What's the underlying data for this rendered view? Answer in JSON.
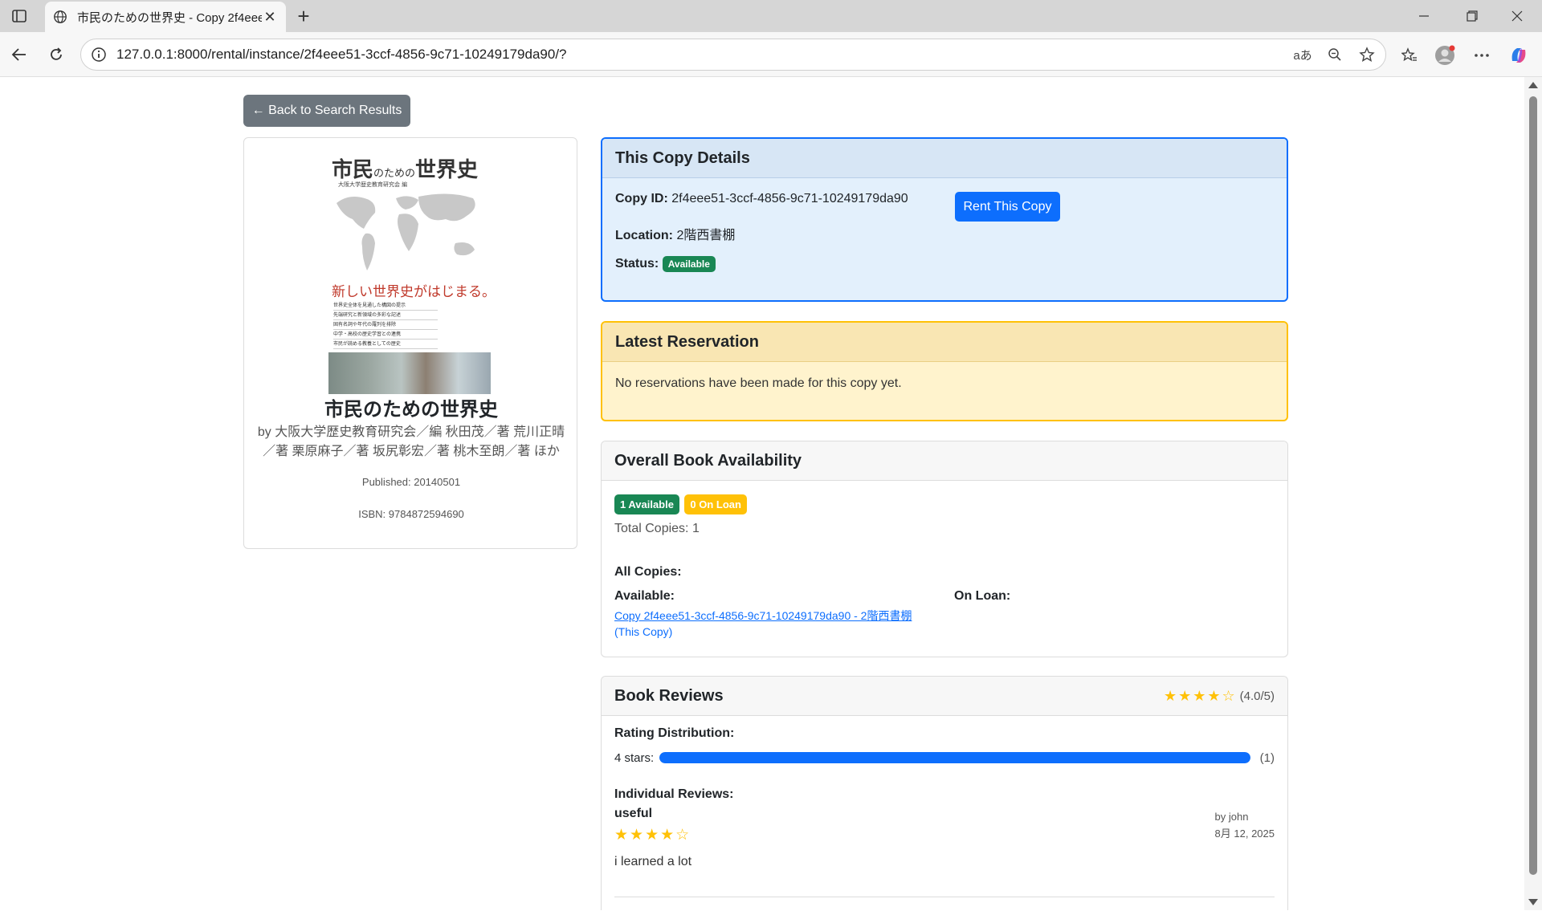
{
  "browser": {
    "tab_title": "市民のための世界史 - Copy 2f4eee",
    "url": "127.0.0.1:8000/rental/instance/2f4eee51-3ccf-4856-9c71-10249179da90/?",
    "translate_icon_text": "aあ"
  },
  "page": {
    "back_button": "← Back to Search Results"
  },
  "book": {
    "cover": {
      "title_a": "市民",
      "title_b": "のための",
      "title_c": "世界史",
      "subtitle": "大阪大学歴史教育研究会 編",
      "tagline": "新しい世界史がはじまる。",
      "lines": [
        "世界史全体を見通した構図の提示",
        "先端研究と新領域の多彩な記述",
        "固有名詞や年代の羅列を排除",
        "中学・高校の歴史学習との連携",
        "市民が読める教養としての歴史"
      ]
    },
    "title": "市民のための世界史",
    "authors": "by 大阪大学歴史教育研究会／編 秋田茂／著 荒川正晴／著 栗原麻子／著 坂尻彰宏／著 桃木至朗／著 ほか",
    "published": "Published: 20140501",
    "isbn": "ISBN: 9784872594690"
  },
  "copy_details": {
    "header": "This Copy Details",
    "copy_id_label": "Copy ID:",
    "copy_id": "2f4eee51-3ccf-4856-9c71-10249179da90",
    "location_label": "Location:",
    "location": "2階西書棚",
    "status_label": "Status:",
    "status": "Available",
    "rent_button": "Rent This Copy"
  },
  "reservation": {
    "header": "Latest Reservation",
    "message": "No reservations have been made for this copy yet."
  },
  "availability": {
    "header": "Overall Book Availability",
    "available_badge": "1 Available",
    "on_loan_badge": "0 On Loan",
    "total": "Total Copies: 1",
    "all_copies_label": "All Copies:",
    "available_label": "Available:",
    "on_loan_label": "On Loan:",
    "copy_link": "Copy 2f4eee51-3ccf-4856-9c71-10249179da90 - 2階西書棚",
    "this_copy_note": "(This Copy)"
  },
  "reviews": {
    "header": "Book Reviews",
    "average_stars": "★★★★☆",
    "average_text": "(4.0/5)",
    "distribution_label": "Rating Distribution:",
    "distribution": [
      {
        "label": "4 stars:",
        "fraction": 1.0,
        "count": "(1)"
      }
    ],
    "individual_label": "Individual Reviews:",
    "items": [
      {
        "title": "useful",
        "stars": "★★★★☆",
        "text": "i learned a lot",
        "author": "by john",
        "date": "8月 12, 2025"
      }
    ]
  },
  "colors": {
    "primary": "#0d6efd",
    "success": "#198754",
    "warning": "#ffc107",
    "secondary": "#6c757d"
  }
}
